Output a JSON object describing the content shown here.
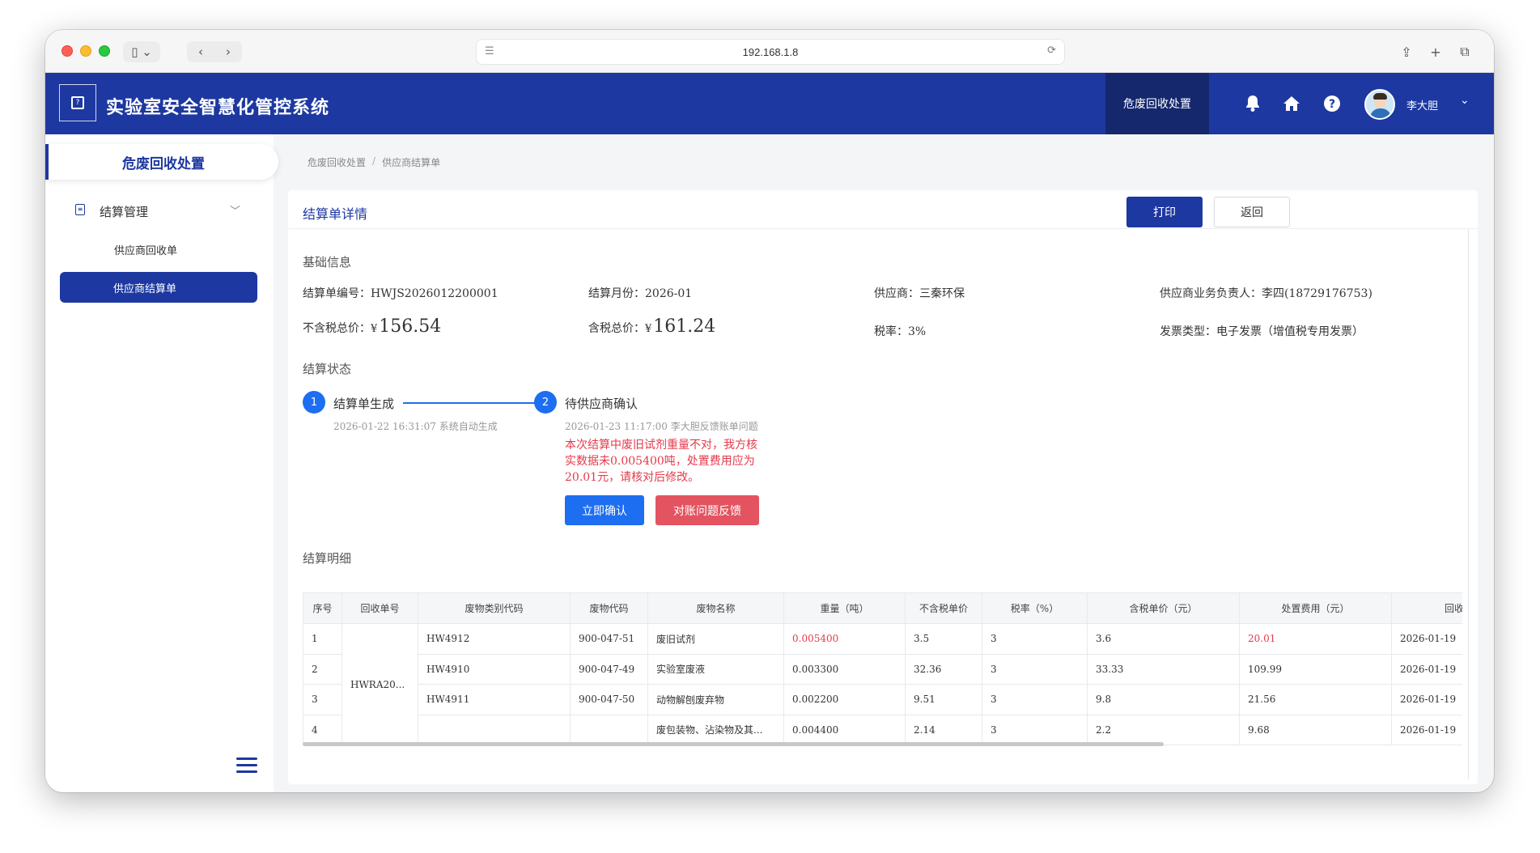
{
  "browser": {
    "url": "192.168.1.8",
    "nav_back": "‹",
    "nav_forward": "›"
  },
  "header": {
    "app_title": "实验室安全智慧化管控系统",
    "module_button": "危废回收处置",
    "user_name": "李大胆"
  },
  "sidebar": {
    "module_title": "危废回收处置",
    "group_label": "结算管理",
    "items": [
      {
        "label": "供应商回收单",
        "active": false
      },
      {
        "label": "供应商结算单",
        "active": true
      }
    ]
  },
  "breadcrumb": {
    "items": [
      "危废回收处置",
      "供应商结算单"
    ],
    "separator": "/"
  },
  "card": {
    "title": "结算单详情",
    "print_button": "打印",
    "back_button": "返回"
  },
  "basic_info": {
    "section_title": "基础信息",
    "settlement_no": "结算单编号：HWJS2026012200001",
    "settlement_month": "结算月份：2026-01",
    "supplier": "供应商：三秦环保",
    "supplier_contact": "供应商业务负责人：李四(18729176753)",
    "pretax_total_label": "不含税总价：",
    "pretax_total_currency": "¥",
    "pretax_total_value": "156.54",
    "tax_total_label": "含税总价：",
    "tax_total_currency": "¥",
    "tax_total_value": "161.24",
    "tax_rate": "税率：3%",
    "invoice_type": "发票类型：电子发票（增值税专用发票）"
  },
  "settlement_status": {
    "section_title": "结算状态",
    "steps": [
      {
        "number": "1",
        "label": "结算单生成",
        "time": "2026-01-22 16:31:07 系统自动生成"
      },
      {
        "number": "2",
        "label": "待供应商确认",
        "time": "2026-01-23 11:17:00 李大胆反馈账单问题",
        "note": "本次结算中废旧试剂重量不对，我方核实数据未0.005400吨，处置费用应为20.01元，请核对后修改。"
      }
    ],
    "confirm_button": "立即确认",
    "feedback_button": "对账问题反馈"
  },
  "details": {
    "section_title": "结算明细",
    "columns": [
      "序号",
      "回收单号",
      "废物类别代码",
      "废物代码",
      "废物名称",
      "重量（吨）",
      "不含税单价",
      "税率（%）",
      "含税单价（元）",
      "处置费用（元）",
      "回收"
    ],
    "merged_order_no": "HWRA20...",
    "rows": [
      {
        "index": "1",
        "category_code": "HW4912",
        "waste_code": "900-047-51",
        "name": "废旧试剂",
        "weight": "0.005400",
        "unit_price": "3.5",
        "tax_rate": "3",
        "tax_unit_price": "3.6",
        "fee": "20.01",
        "date": "2026-01-19"
      },
      {
        "index": "2",
        "category_code": "HW4910",
        "waste_code": "900-047-49",
        "name": "实验室废液",
        "weight": "0.003300",
        "unit_price": "32.36",
        "tax_rate": "3",
        "tax_unit_price": "33.33",
        "fee": "109.99",
        "date": "2026-01-19"
      },
      {
        "index": "3",
        "category_code": "HW4911",
        "waste_code": "900-047-50",
        "name": "动物解刨废弃物",
        "weight": "0.002200",
        "unit_price": "9.51",
        "tax_rate": "3",
        "tax_unit_price": "9.8",
        "fee": "21.56",
        "date": "2026-01-19"
      },
      {
        "index": "4",
        "category_code": "",
        "waste_code": "",
        "name": "废包装物、沾染物及其...",
        "weight": "0.004400",
        "unit_price": "2.14",
        "tax_rate": "3",
        "tax_unit_price": "2.2",
        "fee": "9.68",
        "date": "2026-01-19"
      }
    ]
  },
  "colors": {
    "brand": "#1d38a0",
    "step_blue": "#1d6ef0",
    "alert_red": "#e6394a"
  }
}
